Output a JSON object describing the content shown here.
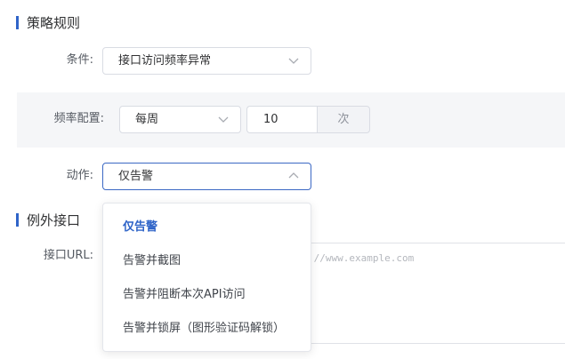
{
  "sections": {
    "strategy_rules": "策略规则",
    "exception_api": "例外接口"
  },
  "condition": {
    "label": "条件:",
    "value": "接口访问频率异常"
  },
  "frequency": {
    "label": "频率配置:",
    "period": "每周",
    "count": "10",
    "unit": "次"
  },
  "action": {
    "label": "动作:",
    "value": "仅告警",
    "options": [
      {
        "label": "仅告警",
        "selected": true
      },
      {
        "label": "告警并截图",
        "selected": false
      },
      {
        "label": "告警并阻断本次API访问",
        "selected": false
      },
      {
        "label": "告警并锁屏（图形验证码解锁）",
        "selected": false
      }
    ]
  },
  "exception": {
    "label": "接口URL:",
    "placeholder": "://www.example.com"
  },
  "colors": {
    "accent": "#2f64c8",
    "border": "#d9dce3",
    "band": "#f5f6f8"
  }
}
